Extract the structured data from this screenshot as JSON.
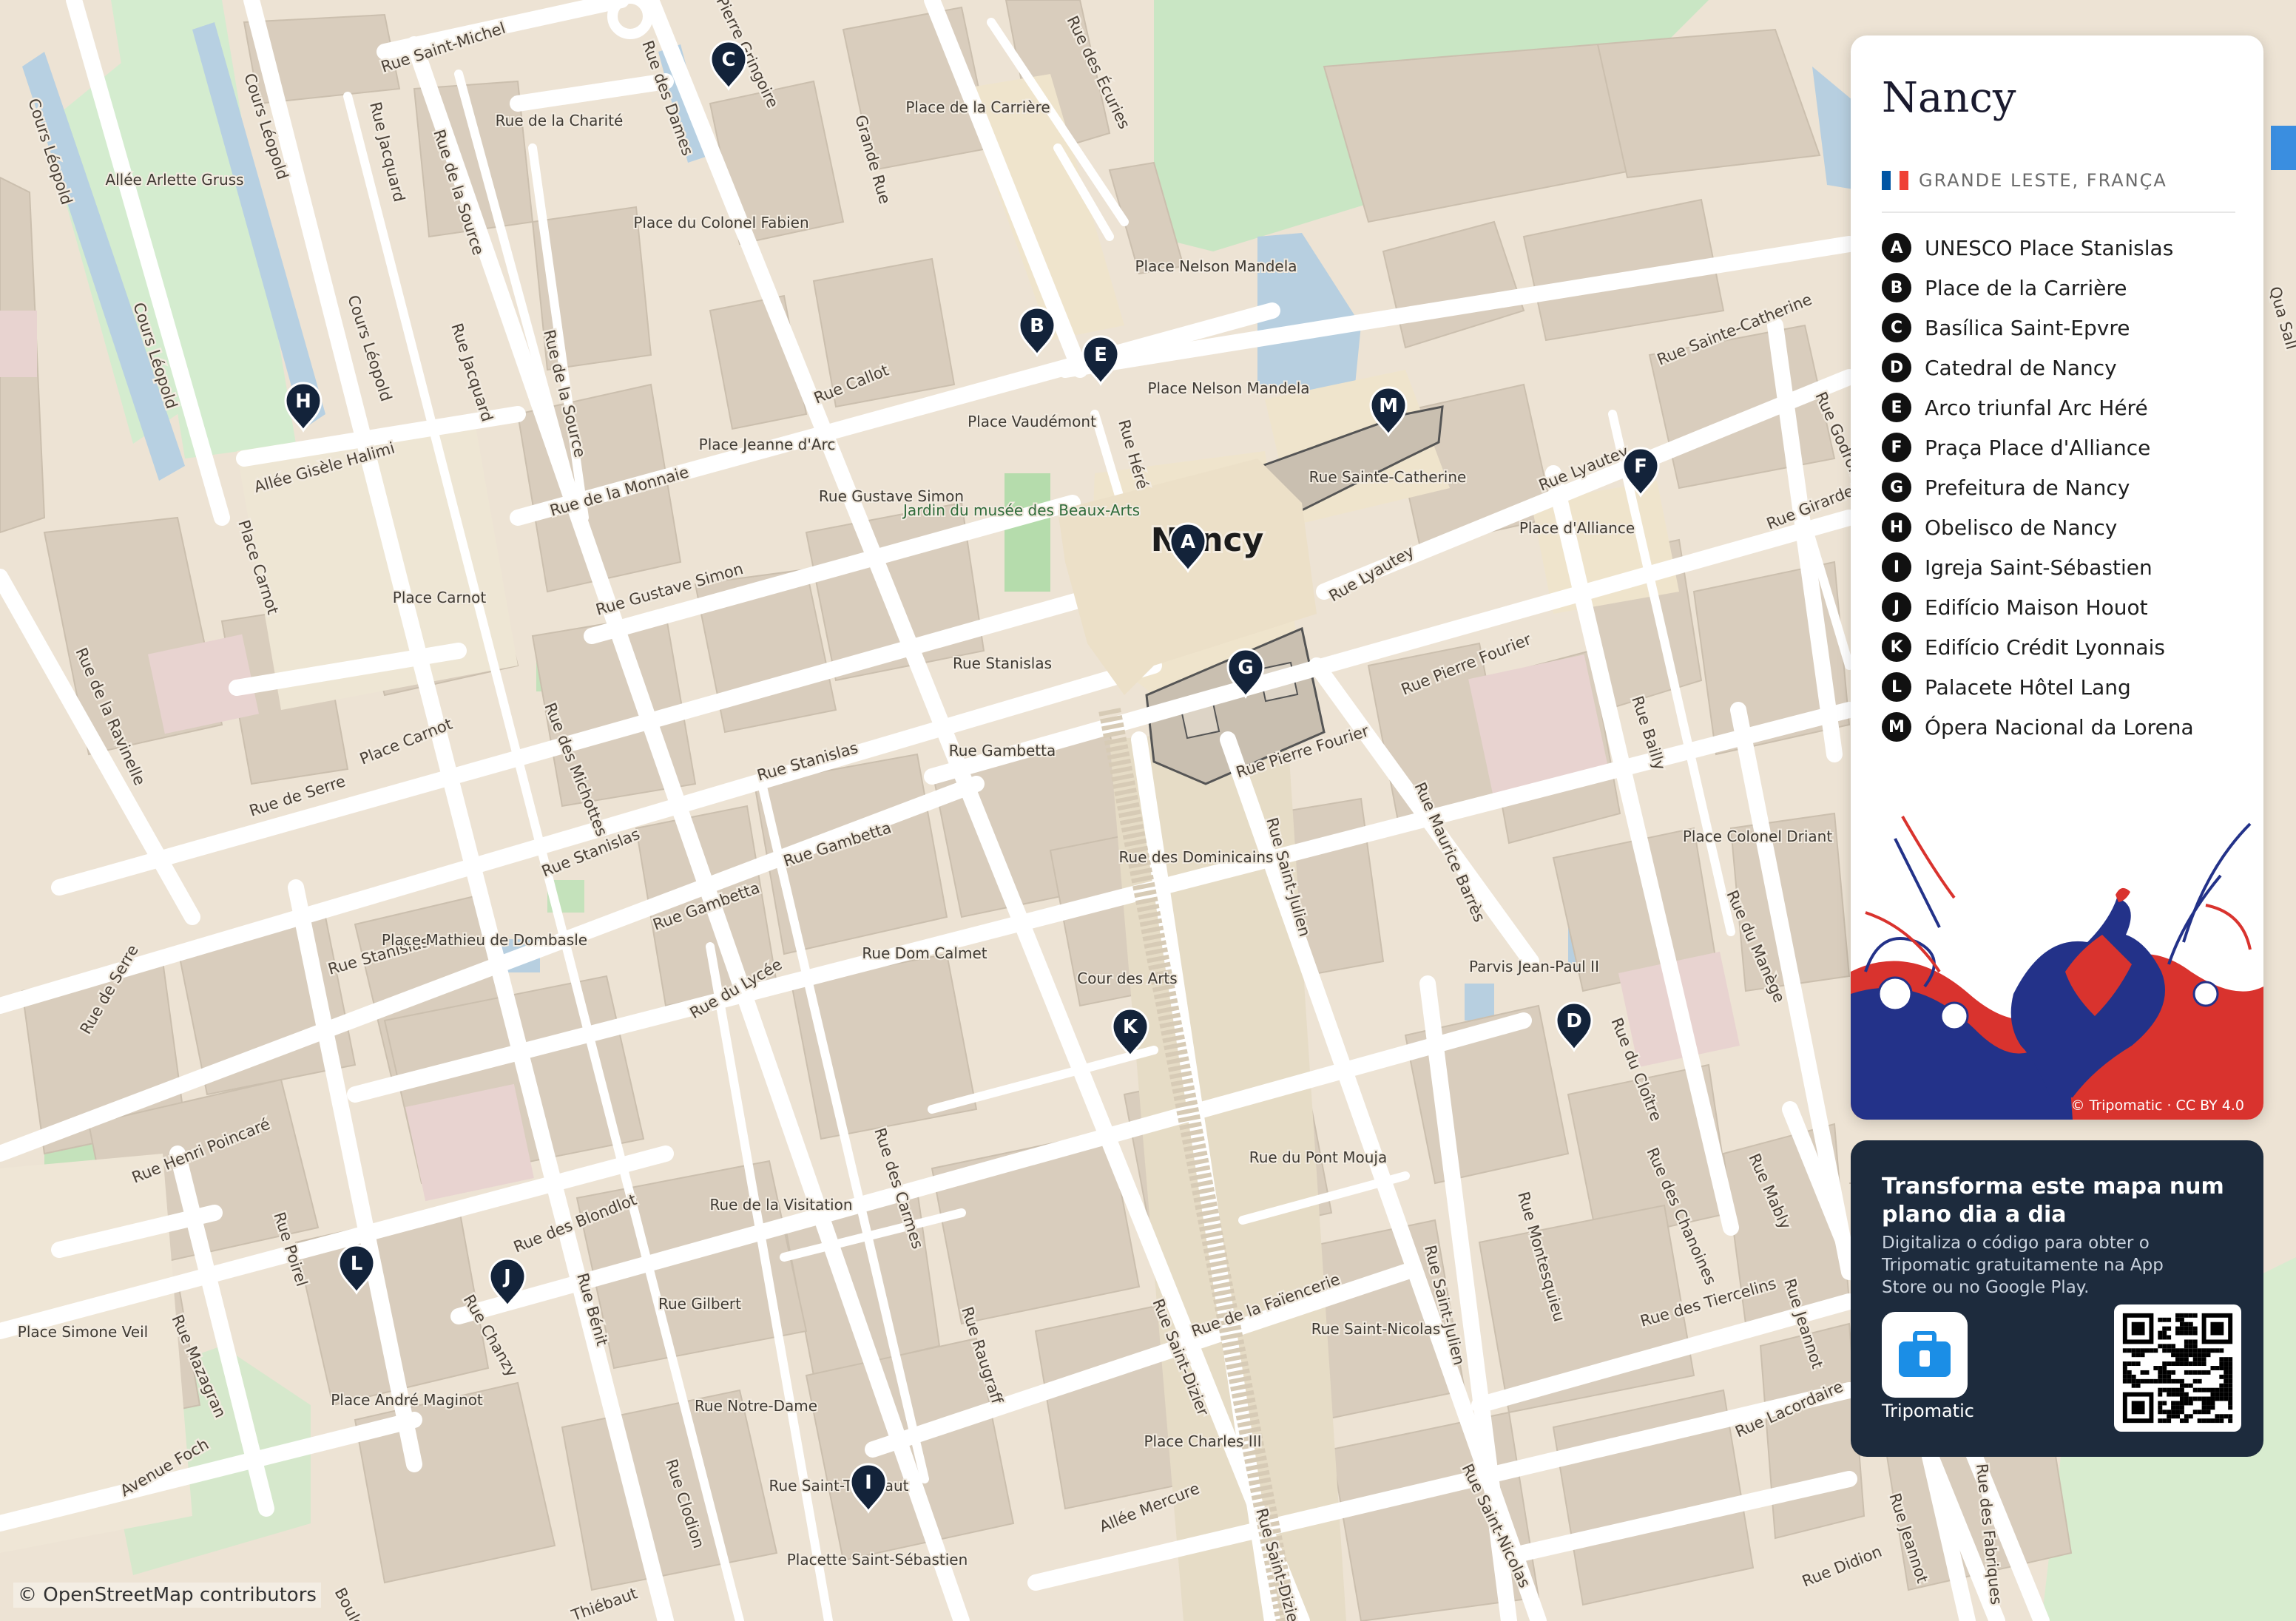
{
  "map": {
    "city_label": "Nancy",
    "attribution": "© OpenStreetMap contributors",
    "streets": [
      "Rue Saint-Michel",
      "Cours Léopold",
      "Cours Léopold",
      "Cours Léopold",
      "Cours Léopold",
      "Rue Jacquard",
      "Rue Jacquard",
      "Rue de la Source",
      "Rue de la Source",
      "Rue des Dames",
      "Pierre Gringoire",
      "Grande Rue",
      "Rue des Écuries",
      "Rue Callot",
      "Rue de la Monnaie",
      "Rue Gustave Simon",
      "Allée Gisèle Halimi",
      "Place Carnot",
      "Rue de la Ravinelle",
      "Place Carnot",
      "Rue de Serre",
      "Rue de Serre",
      "Rue des Michottes",
      "Rue Stanislas",
      "Rue Stanislas",
      "Rue Stanislas",
      "Rue Gambetta",
      "Rue Gambetta",
      "Rue du Lycée",
      "Rue Henri Poincaré",
      "Rue des Blondlot",
      "Rue Poirel",
      "Rue Chanzy",
      "Rue Bénit",
      "Rue Mazagran",
      "Avenue Foch",
      "Rue Clodion",
      "Rue des Carmes",
      "Rue Raugraff",
      "Rue Saint-Dizier",
      "Rue Saint-Dizier",
      "Allée Mercure",
      "Rue Héré",
      "Rue Sainte-Catherine",
      "Rue Lyautey",
      "Rue Lyautey",
      "Rue Girardet",
      "Rue Godron",
      "Rue Pierre Fourier",
      "Rue Pierre Fourier",
      "Rue Saint-Julien",
      "Rue Saint-Julien",
      "Rue Maurice Barrès",
      "Rue Bailly",
      "Rue du Manège",
      "Rue du Cloître",
      "Rue Montesquieu",
      "Rue des Chanoines",
      "Rue Mably",
      "Rue des Tiercelins",
      "Rue Jeannot",
      "Rue Jeannot",
      "Rue Lacordaire",
      "Rue Saint-Nicolas",
      "Rue de la Faïencerie",
      "Rue Didion",
      "Rue des Fabriques",
      "Thiébaut",
      "Boulev",
      "Qua Sall"
    ],
    "places": [
      "Rue de la Charité",
      "Place de la Carrière",
      "Place du Colonel Fabien",
      "Allée Arlette Gruss",
      "Place Nelson Mandela",
      "Place Nelson Mandela",
      "Place Vaudémont",
      "Place Jeanne d'Arc",
      "Rue Gustave Simon",
      "Jardin du musée des Beaux-Arts",
      "Place Carnot",
      "Rue Sainte-Catherine",
      "Place d'Alliance",
      "Rue Stanislas",
      "Rue Gambetta",
      "Rue des Dominicains",
      "Place Mathieu de Dombasle",
      "Rue Dom Calmet",
      "Cour des Arts",
      "Parvis Jean-Paul II",
      "Place Colonel Driant",
      "Rue de la Visitation",
      "Rue Gilbert",
      "Place Simone Veil",
      "Place André Maginot",
      "Rue Notre-Dame",
      "Rue Saint-Thiébaut",
      "Placette Saint-Sébastien",
      "Rue du Pont Mouja",
      "Rue Saint-Nicolas",
      "Place Charles III"
    ],
    "pins": [
      "A",
      "B",
      "C",
      "D",
      "E",
      "F",
      "G",
      "H",
      "I",
      "J",
      "K",
      "L",
      "M"
    ]
  },
  "panel": {
    "title": "Nancy",
    "subtitle": "GRANDE LESTE, FRANÇA",
    "flag_colors": [
      "#0055a4",
      "#ffffff",
      "#ef4135"
    ],
    "art_credit": "© Tripomatic · CC BY 4.0",
    "items": [
      {
        "letter": "A",
        "name": "UNESCO Place Stanislas"
      },
      {
        "letter": "B",
        "name": "Place de la Carrière"
      },
      {
        "letter": "C",
        "name": "Basílica Saint-Epvre"
      },
      {
        "letter": "D",
        "name": "Catedral de Nancy"
      },
      {
        "letter": "E",
        "name": "Arco triunfal Arc Héré"
      },
      {
        "letter": "F",
        "name": "Praça Place d'Alliance"
      },
      {
        "letter": "G",
        "name": "Prefeitura de Nancy"
      },
      {
        "letter": "H",
        "name": "Obelisco de Nancy"
      },
      {
        "letter": "I",
        "name": "Igreja Saint-Sébastien"
      },
      {
        "letter": "J",
        "name": "Edifício Maison Houot"
      },
      {
        "letter": "K",
        "name": "Edifício Crédit Lyonnais"
      },
      {
        "letter": "L",
        "name": "Palacete Hôtel Lang"
      },
      {
        "letter": "M",
        "name": "Ópera Nacional da Lorena"
      }
    ]
  },
  "promo": {
    "title": "Transforma este mapa num plano dia a dia",
    "text": "Digitaliza o código para obter o Tripomatic gratuitamente na App Store ou no Google Play.",
    "app_name": "Tripomatic",
    "app_icon": "suitcase-icon"
  },
  "colors": {
    "background": "#ede3d4",
    "building": "#d9cdbd",
    "street": "#ffffff",
    "park": "#cfe8c8",
    "water": "#aac6dc",
    "pin": "#13233a",
    "promo_bg": "#1d2b3d"
  }
}
